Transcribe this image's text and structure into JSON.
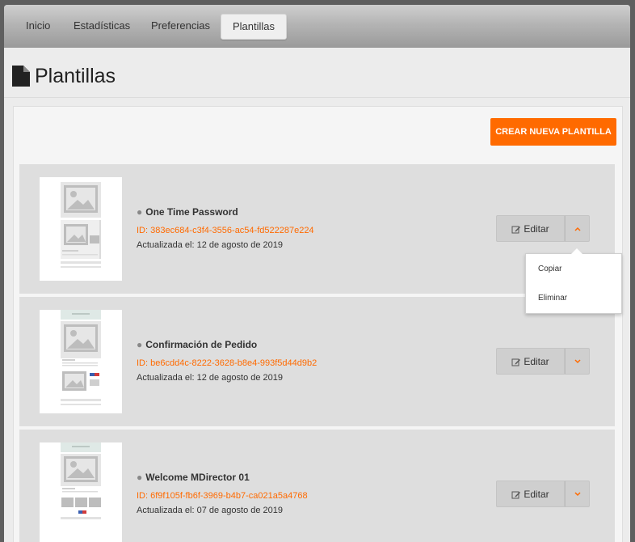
{
  "nav": {
    "tabs": [
      {
        "label": "Inicio"
      },
      {
        "label": "Estadísticas"
      },
      {
        "label": "Preferencias"
      },
      {
        "label": "Plantillas",
        "active": true
      }
    ]
  },
  "page": {
    "title": "Plantillas",
    "title_icon": "document-icon",
    "create_button": "CREAR NUEVA PLANTILLA"
  },
  "colors": {
    "accent": "#ff6a00",
    "card_bg": "#dedede"
  },
  "templates": [
    {
      "name": "One Time Password",
      "id": "ID: 383ec684-c3f4-3556-ac54-fd522287e224",
      "updated": "Actualizada el: 12 de agosto de 2019",
      "edit_label": "Editar",
      "menu_open": true
    },
    {
      "name": "Confirmación de Pedido",
      "id": "ID: be6cdd4c-8222-3628-b8e4-993f5d44d9b2",
      "updated": "Actualizada el: 12 de agosto de 2019",
      "edit_label": "Editar",
      "menu_open": false
    },
    {
      "name": "Welcome MDirector 01",
      "id": "ID: 6f9f105f-fb6f-3969-b4b7-ca021a5a4768",
      "updated": "Actualizada el: 07 de agosto de 2019",
      "edit_label": "Editar",
      "menu_open": false
    }
  ],
  "dropdown": {
    "items": [
      "Copiar",
      "Eliminar"
    ]
  }
}
